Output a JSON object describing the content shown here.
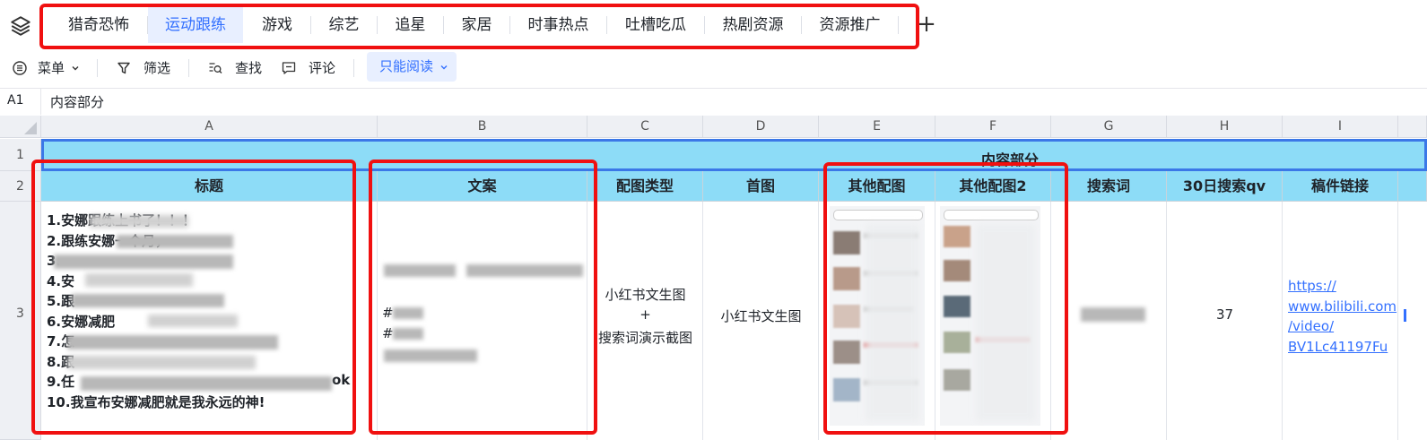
{
  "tabs": [
    "猎奇恐怖",
    "运动跟练",
    "游戏",
    "综艺",
    "追星",
    "家居",
    "时事热点",
    "吐槽吃瓜",
    "热剧资源",
    "资源推广"
  ],
  "active_tab_index": 1,
  "toolbar": {
    "menu": "菜单",
    "filter": "筛选",
    "find": "查找",
    "comment": "评论",
    "readonly": "只能阅读"
  },
  "formula": {
    "cell_ref": "A1",
    "value": "内容部分"
  },
  "columns": [
    "A",
    "B",
    "C",
    "D",
    "E",
    "F",
    "G",
    "H",
    "I"
  ],
  "rows": [
    "1",
    "2",
    "3"
  ],
  "merged_header": "内容部分",
  "headers": [
    "标题",
    "文案",
    "配图类型",
    "首图",
    "其他配图",
    "其他配图2",
    "搜索词",
    "30日搜索qv",
    "稿件链接"
  ],
  "row3": {
    "titles": [
      "1.安娜跟练上书了！！！",
      "2.跟练安娜一个月，",
      "3.",
      "4.安",
      "5.跟",
      "6.安娜减肥",
      "7.怎",
      "8.跟",
      "9.任",
      "10.我宣布安娜减肥就是我永远的神!"
    ],
    "title_suffix_9": "ok",
    "copy_lines": [
      "#",
      "#"
    ],
    "image_type_line1": "小红书文生图",
    "image_type_plus": "+",
    "image_type_line2": "搜索词演示截图",
    "first_image": "小红书文生图",
    "qv": "37",
    "link_lines": [
      "https://",
      "www.bilibili.com",
      "/video/",
      "BV1Lc41197Fu"
    ]
  },
  "colors": {
    "accent": "#3370ff",
    "header_bg": "#8ddcf7",
    "annotation": "#f01010",
    "selection": "#3b78e7"
  }
}
